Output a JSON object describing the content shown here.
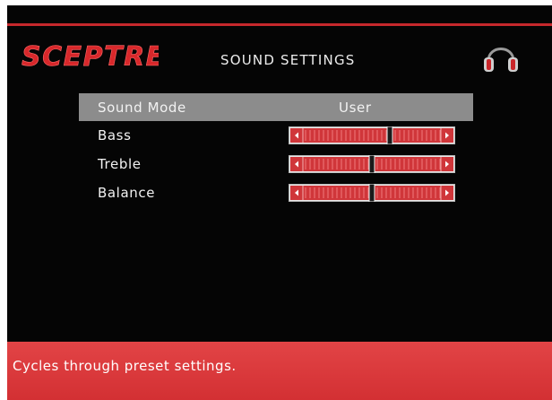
{
  "brand": {
    "logo_text": "SCEPTRE"
  },
  "header": {
    "title": "SOUND SETTINGS",
    "icon": "headphones-icon"
  },
  "menu": {
    "sound_mode": {
      "label": "Sound Mode",
      "value": "User"
    },
    "bass": {
      "label": "Bass",
      "level": 0.63
    },
    "treble": {
      "label": "Treble",
      "level": 0.5
    },
    "balance": {
      "label": "Balance",
      "level": 0.5
    }
  },
  "help": {
    "text": "Cycles through preset settings."
  },
  "colors": {
    "accent": "#c6282c",
    "slider_fill": "#d0363a",
    "selection": "#8c8c8c",
    "background": "#050505",
    "help_bar": "#d33033"
  }
}
